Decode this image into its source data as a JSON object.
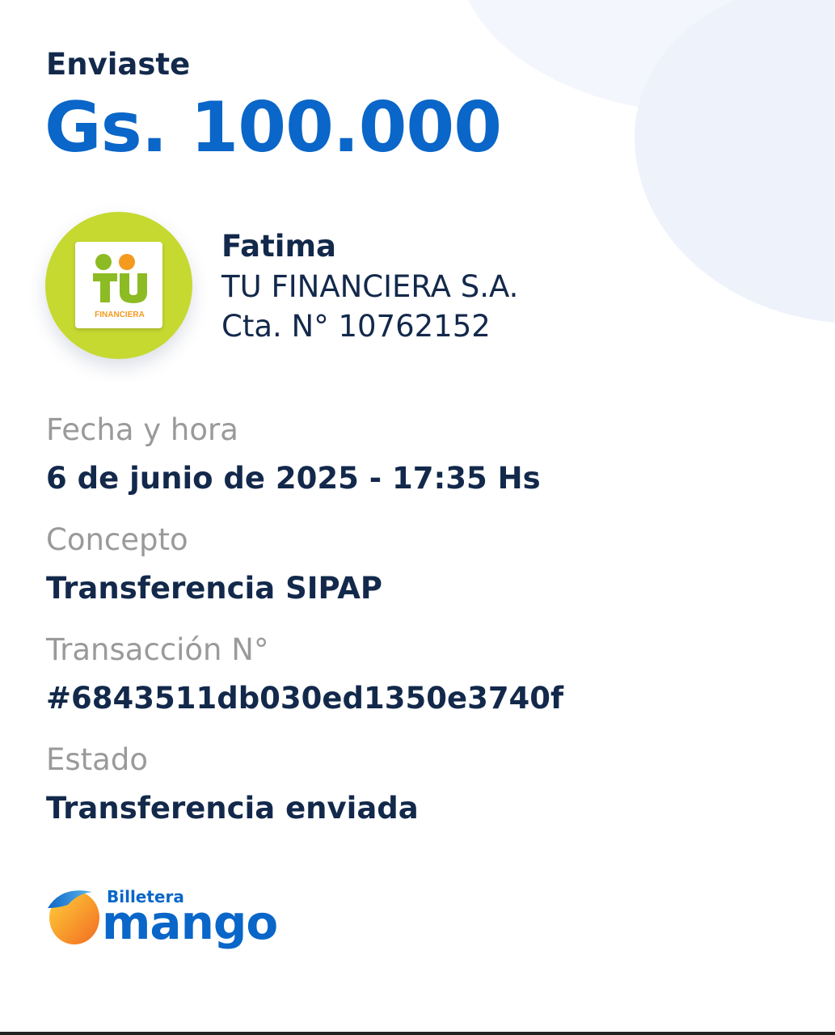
{
  "receipt": {
    "title": "Enviaste",
    "amount": "Gs. 100.000"
  },
  "recipient": {
    "name": "Fatima",
    "bank": "TU FINANCIERA S.A.",
    "account": "Cta. N° 10762152",
    "logo_text": "FINANCIERA",
    "logo_mark": "TU"
  },
  "details": [
    {
      "label": "Fecha y hora",
      "value": "6 de junio de 2025 - 17:35 Hs"
    },
    {
      "label": "Concepto",
      "value": "Transferencia SIPAP"
    },
    {
      "label": "Transacción N°",
      "value": "#6843511db030ed1350e3740f"
    },
    {
      "label": "Estado",
      "value": "Transferencia enviada"
    }
  ],
  "brand": {
    "small": "Billetera",
    "big": "mango",
    "icon": "mango-fruit-icon"
  },
  "colors": {
    "primary": "#0a66c8",
    "text_dark": "#13294b",
    "text_muted": "#9a9a9a",
    "logo_green": "#c6d930",
    "logo_orange": "#f39a1f"
  }
}
